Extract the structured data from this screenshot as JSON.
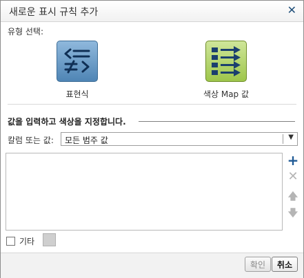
{
  "dialog": {
    "title": "새로운 표시 규칙 추가"
  },
  "type_select": {
    "label": "유형 선택:",
    "options": [
      {
        "label": "표현식",
        "icon": "expression-icon",
        "color": "#4f85b5"
      },
      {
        "label": "색상 Map 값",
        "icon": "color-map-values-icon",
        "color": "#9ec64b"
      }
    ]
  },
  "section": {
    "title": "값을 입력하고 색상을 지정합니다."
  },
  "column": {
    "label": "칼럼 또는 값:",
    "selected": "모든 범주 값"
  },
  "list": {
    "items": []
  },
  "list_actions": [
    {
      "name": "add",
      "icon": "plus-icon",
      "enabled": true
    },
    {
      "name": "delete",
      "icon": "x-icon",
      "enabled": false
    },
    {
      "name": "move-up",
      "icon": "arrow-up-icon",
      "enabled": false
    },
    {
      "name": "move-down",
      "icon": "arrow-down-icon",
      "enabled": false
    }
  ],
  "other": {
    "label": "기타",
    "checked": false,
    "swatch_color": "#cfcfcf"
  },
  "footer": {
    "ok_label": "확인",
    "cancel_label": "취소"
  }
}
